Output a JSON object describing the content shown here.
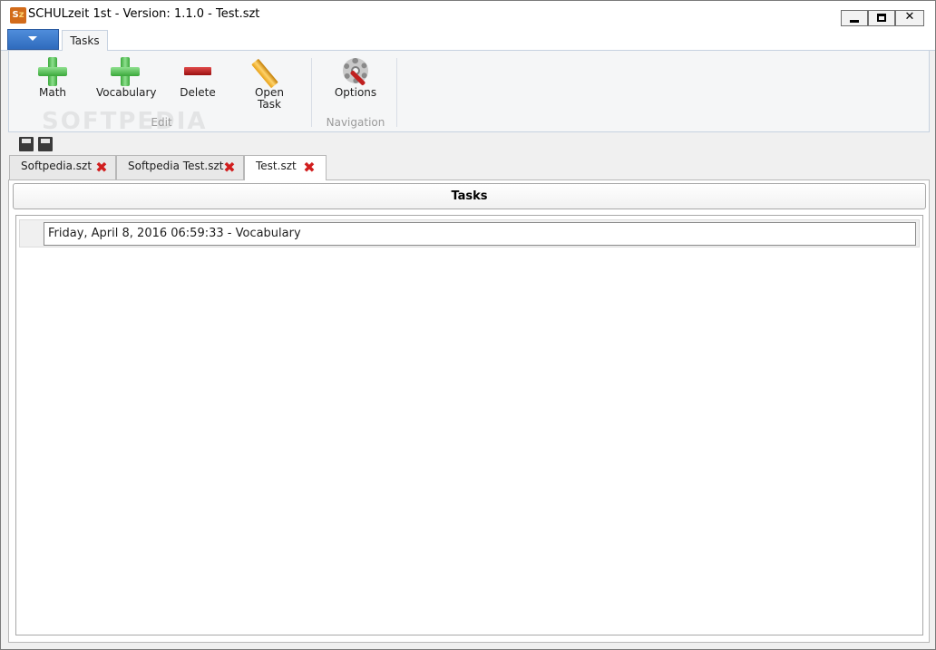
{
  "window": {
    "title": "SCHULzeit 1st - Version: 1.1.0 - Test.szt",
    "app_icon_letters": "S",
    "app_icon_letters_2": "z",
    "controls": {
      "minimize": "minimize-icon",
      "maximize": "maximize-icon",
      "close": "✕"
    }
  },
  "ribbon": {
    "app_menu_icon": "dropdown-arrow-icon",
    "tabs": [
      {
        "label": "Tasks",
        "active": true
      }
    ],
    "groups": [
      {
        "label": "Edit",
        "buttons": [
          {
            "label": "Math",
            "icon": "plus-green-icon"
          },
          {
            "label": "Vocabulary",
            "icon": "plus-green-icon"
          },
          {
            "label": "Delete",
            "icon": "minus-red-icon"
          },
          {
            "label_line1": "Open",
            "label_line2": "Task",
            "icon": "pencil-icon"
          }
        ]
      },
      {
        "label": "Navigation",
        "buttons": [
          {
            "label": "Options",
            "icon": "gear-icon"
          }
        ]
      }
    ]
  },
  "toolbar": {
    "icons": [
      "save-as-icon",
      "save-icon"
    ]
  },
  "documents": {
    "tabs": [
      {
        "label": "Softpedia.szt",
        "active": false
      },
      {
        "label": "Softpedia Test.szt",
        "active": false
      },
      {
        "label": "Test.szt",
        "active": true
      }
    ],
    "close_glyph": "✖"
  },
  "content": {
    "header": "Tasks",
    "tasks": [
      {
        "label": "Friday, April 8, 2016 06:59:33 - Vocabulary"
      }
    ]
  },
  "colors": {
    "accent": "#2f6bbd",
    "add": "#3aa83a",
    "delete": "#c01818",
    "close_tab": "#d11e1e"
  }
}
